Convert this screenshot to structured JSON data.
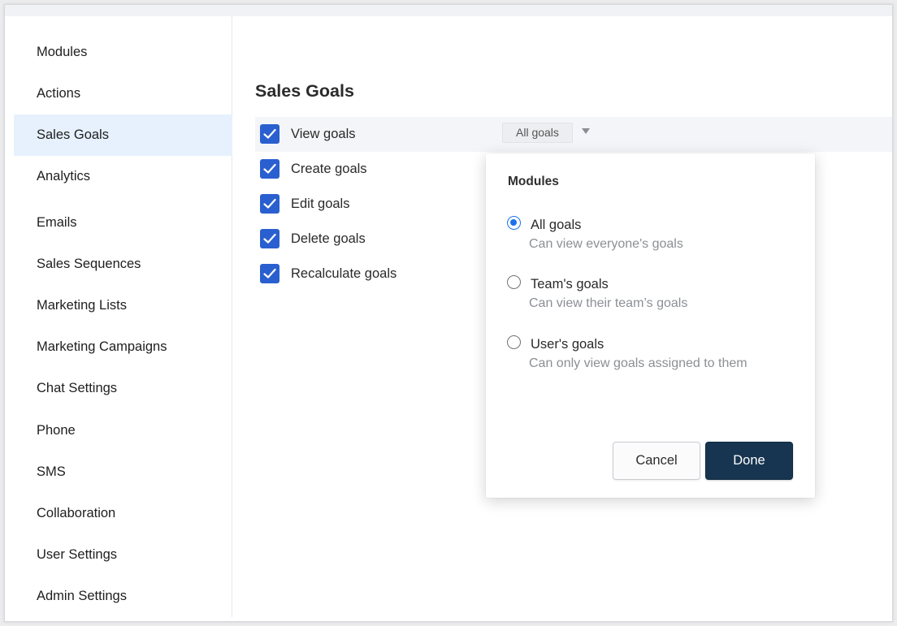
{
  "sidebar": {
    "items": [
      {
        "label": "Modules"
      },
      {
        "label": "Actions"
      },
      {
        "label": "Sales Goals",
        "active": true
      },
      {
        "label": "Analytics"
      },
      {
        "label": "Emails"
      },
      {
        "label": "Sales Sequences"
      },
      {
        "label": "Marketing Lists"
      },
      {
        "label": "Marketing Campaigns"
      },
      {
        "label": "Chat Settings"
      },
      {
        "label": "Phone"
      },
      {
        "label": "SMS"
      },
      {
        "label": "Collaboration"
      },
      {
        "label": "User Settings"
      },
      {
        "label": "Admin Settings"
      }
    ]
  },
  "main": {
    "title": "Sales Goals",
    "permissions": [
      {
        "label": "View goals",
        "checked": true
      },
      {
        "label": "Create goals",
        "checked": true
      },
      {
        "label": "Edit goals",
        "checked": true
      },
      {
        "label": "Delete goals",
        "checked": true
      },
      {
        "label": "Recalculate goals",
        "checked": true
      }
    ],
    "view_scope_value": "All goals"
  },
  "popover": {
    "title": "Modules",
    "options": [
      {
        "label": "All goals",
        "description": "Can view everyone's goals",
        "selected": true
      },
      {
        "label": "Team's goals",
        "description": "Can view their team’s goals",
        "selected": false
      },
      {
        "label": "User's goals",
        "description": "Can only view goals assigned to them",
        "selected": false
      }
    ],
    "cancel_label": "Cancel",
    "done_label": "Done"
  },
  "colors": {
    "accent": "#2a5fd0",
    "radio_selected": "#1a73e8",
    "primary_button": "#173550",
    "sidebar_active_bg": "#e6f1fd"
  },
  "icons": {
    "checkbox_check": "check-icon",
    "dropdown": "caret-down-icon"
  }
}
